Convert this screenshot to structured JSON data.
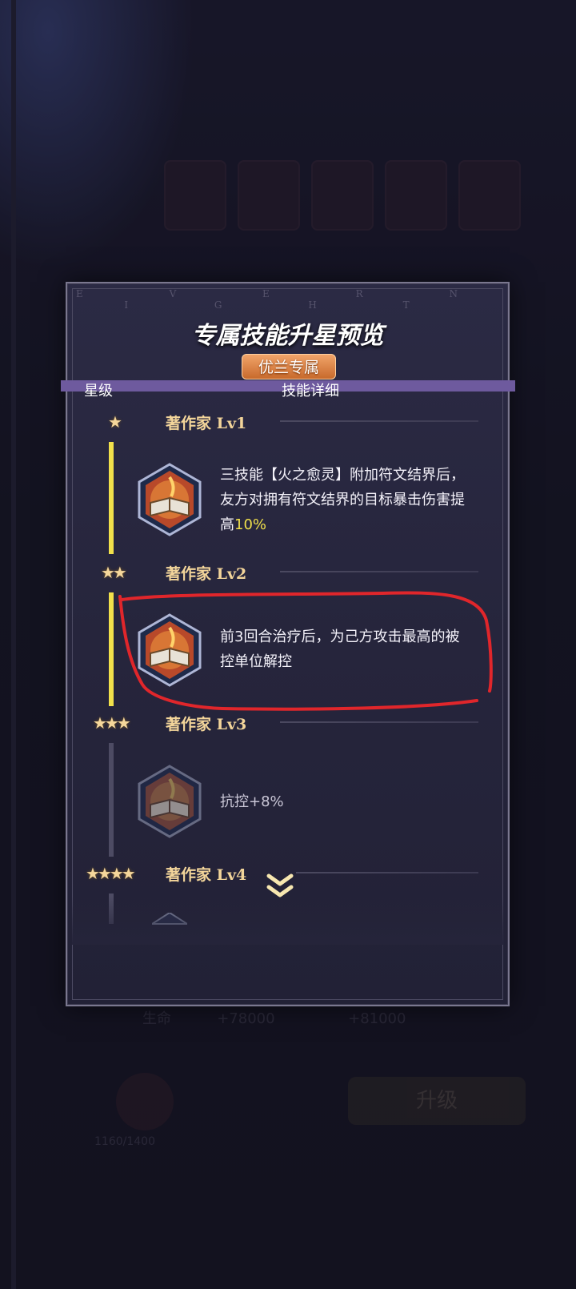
{
  "panel": {
    "watermark": "E V E R N I G H T",
    "title": "专属技能升星预览",
    "badge": "优兰专属",
    "col_star": "星级",
    "col_detail": "技能详细"
  },
  "levels": [
    {
      "title": "著作家",
      "lv": "Lv1",
      "stars": 1,
      "desc_a": "三技能【火之愈灵】附加符文结界后，友方对拥有符文结界的目标暴击伤害提高",
      "desc_hl": "10%"
    },
    {
      "title": "著作家",
      "lv": "Lv2",
      "stars": 2,
      "desc_a": "前3回合治疗后，为己方攻击最高的被控单位解控",
      "desc_hl": ""
    },
    {
      "title": "著作家",
      "lv": "Lv3",
      "stars": 3,
      "desc_a": "抗控+8%",
      "desc_hl": ""
    },
    {
      "title": "著作家",
      "lv": "Lv4",
      "stars": 4,
      "desc_a": "",
      "desc_hl": ""
    }
  ],
  "background": {
    "stat_row_name": "生命",
    "stat_row_old": "+78000",
    "stat_row_new": "+81000",
    "upgrade_button": "升级",
    "exp_text": "1160/1400"
  },
  "colors": {
    "accent_yellow": "#f1e04b",
    "title_gold": "#f3d59a",
    "badge_orange": "#d97a3a",
    "annotation_red": "#e0262b"
  }
}
